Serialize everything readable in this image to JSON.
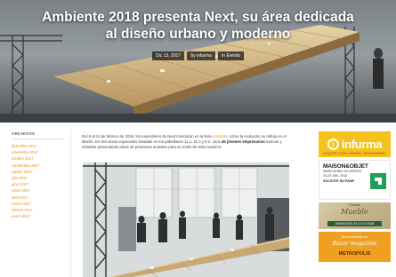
{
  "article": {
    "title": "Ambiente 2018 presenta Next, su área dedicada al diseño urbano y moderno",
    "meta": {
      "date": "Dic 13, 2017",
      "author": "by infurma",
      "category": "in Evento"
    },
    "intro": {
      "part1": "Del 9 al 13 de febrero de 2018, los expositores de Next mostrarán en la feria ",
      "link": "Ambiente",
      "part2": " cómo la evolución se refleja en el diseño. En tres áreas especiales situadas en los pabellones 11.1, 11.0 y 9.2, unos ",
      "bold": "40 jóvenes empresarios",
      "part3": " marcan y estudian presentando ideas de productos actuales para un estilo de vida moderno."
    }
  },
  "sidebar": {
    "heading": "ARCHIVOS",
    "items": [
      "diciembre 2017",
      "noviembre 2017",
      "octubre 2017",
      "septiembre 2017",
      "agosto 2017",
      "julio 2017",
      "junio 2017",
      "mayo 2017",
      "abril 2017",
      "marzo 2017",
      "febrero 2017",
      "enero 2017"
    ]
  },
  "ads": {
    "infurma": {
      "icon": "info-icon",
      "name": "infurma",
      "tagline": "ARQUITECTURA • DISEÑO • INTERIORISMO"
    },
    "maison": {
      "title": "MAISON&OBJET",
      "line1": "PARIS NORD VILLEPINTE",
      "line2": "19-23 JAN. 2018",
      "cta": "SOLICITE SU PASE",
      "logo_color": "#1fa05a"
    },
    "marble": {
      "top": "Feria del",
      "title": "Mueble",
      "date": "ZARAGOZA 24-27.01.2018"
    },
    "metropolis": {
      "line1": "Su anunciante en",
      "line2": "Bazar magazine",
      "line3": "METROPOLIS"
    }
  },
  "colors": {
    "accent": "#e08d1c",
    "infurma_yellow": "#f5c11c",
    "metro_orange": "#f0a020"
  }
}
